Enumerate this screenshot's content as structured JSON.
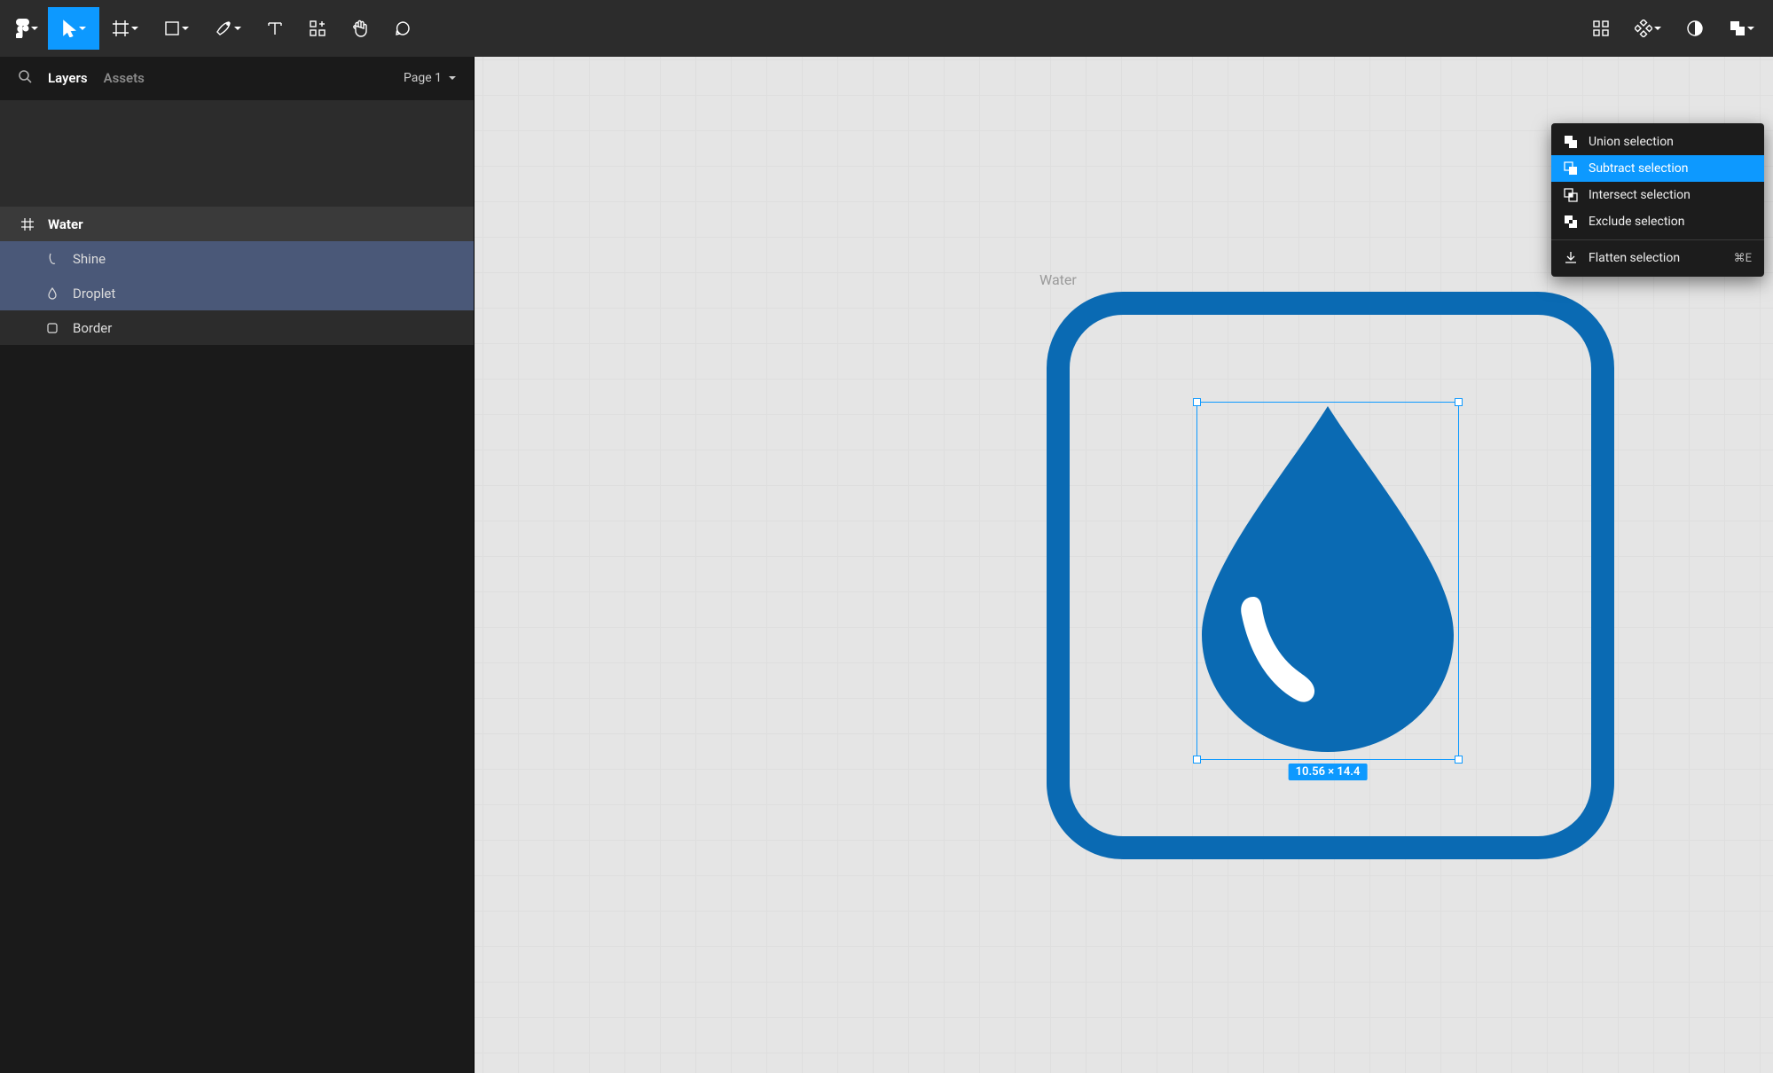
{
  "panel": {
    "tabs": {
      "layers": "Layers",
      "assets": "Assets"
    },
    "page_label": "Page 1"
  },
  "layers": {
    "frame": "Water",
    "shine": "Shine",
    "droplet": "Droplet",
    "border": "Border"
  },
  "canvas": {
    "frame_label": "Water",
    "selection_dimensions": "10.56 × 14.4"
  },
  "boolean_menu": {
    "union": "Union selection",
    "subtract": "Subtract selection",
    "intersect": "Intersect selection",
    "exclude": "Exclude selection",
    "flatten": "Flatten selection",
    "flatten_shortcut": "⌘E"
  },
  "colors": {
    "accent": "#0d99ff",
    "icon_blue": "#0a6ab3"
  }
}
